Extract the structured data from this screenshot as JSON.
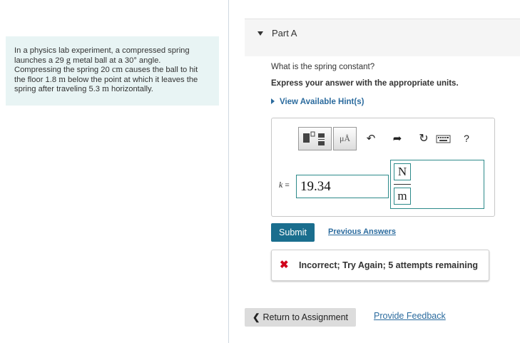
{
  "problem": {
    "lines": [
      "In a physics lab experiment, a compressed spring",
      "launches a 29",
      "metal ball at a 30° angle.",
      "Compressing the spring 20",
      "causes the ball to hit",
      "the floor 1.8",
      "below the point at which it leaves the",
      "spring after traveling 5.3",
      "horizontally."
    ],
    "unit_g": "g",
    "unit_cm": "cm",
    "unit_m": "m"
  },
  "part": {
    "title": "Part A"
  },
  "question": {
    "text": "What is the spring constant?",
    "instruction": "Express your answer with the appropriate units.",
    "hint_link": "View Available Hint(s)"
  },
  "toolbar": {
    "templates_icon": "templates-icon",
    "units_label": "μÅ",
    "undo_icon": "undo-arrow-icon",
    "redo_icon": "redo-arrow-icon",
    "reset_icon": "reset-icon",
    "keyboard_icon": "keyboard-icon",
    "help_label": "?"
  },
  "answer": {
    "variable": "k",
    "equals": "=",
    "value": "19.34",
    "unit_numerator": "N",
    "unit_denominator": "m"
  },
  "actions": {
    "submit_label": "Submit",
    "previous_answers": "Previous Answers"
  },
  "feedback": {
    "status": "incorrect",
    "message": "Incorrect; Try Again; 5 attempts remaining",
    "color": "#d0021b"
  },
  "footer": {
    "return_label": "Return to Assignment",
    "provide_feedback": "Provide Feedback"
  }
}
